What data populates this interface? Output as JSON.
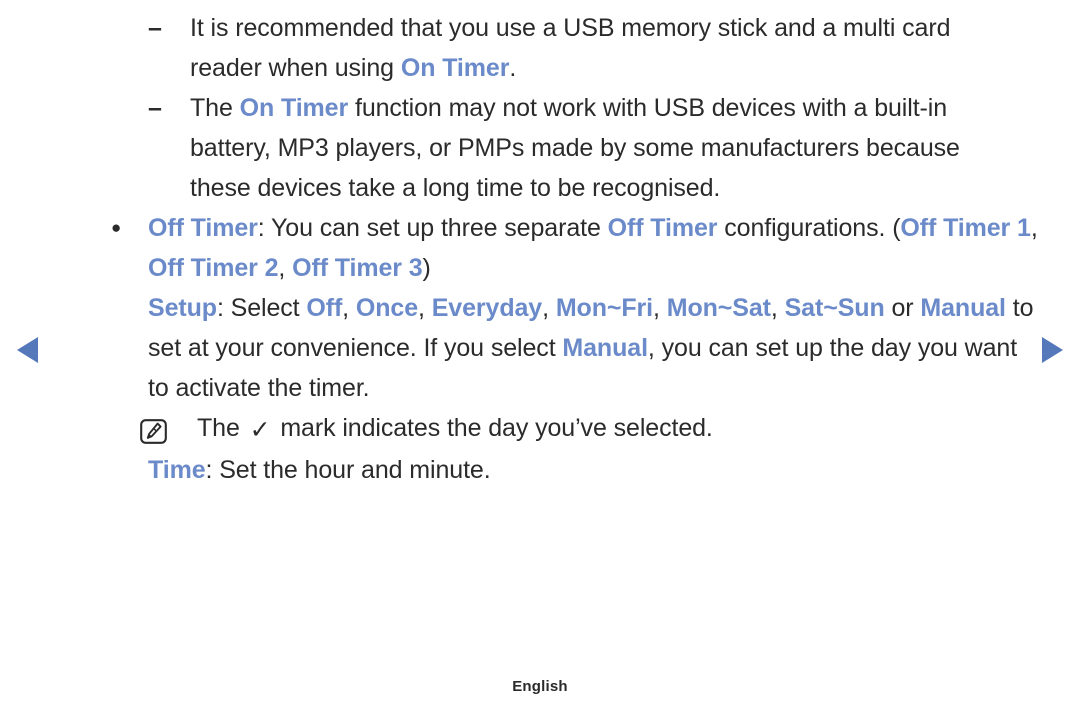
{
  "accent_color": "#6b8ac9",
  "text_color": "#2b2b2b",
  "nav": {
    "prev_label": "previous page",
    "next_label": "next page"
  },
  "body": {
    "note1": {
      "marker": "–",
      "text_1": "It is recommended that you use a USB memory stick and a multi card reader when using ",
      "term_1": "On Timer",
      "text_2": "."
    },
    "note2": {
      "marker": "–",
      "text_1": "The ",
      "term_1": "On Timer",
      "text_2": " function may not work with USB devices with a built-in battery, MP3 players, or PMPs made by some manufacturers because these devices take a long time to be recognised."
    },
    "offtimer": {
      "marker": "●",
      "term_1": "Off Timer",
      "text_1": ": You can set up three separate ",
      "term_2": "Off Timer",
      "text_2": " configurations. (",
      "term_3": "Off Timer 1",
      "text_3": ", ",
      "term_4": "Off Timer 2",
      "text_4": ", ",
      "term_5": "Off Timer 3",
      "text_5": ")"
    },
    "setup": {
      "term_1": "Setup",
      "text_1": ": Select ",
      "term_2": "Off",
      "text_2": ", ",
      "term_3": "Once",
      "text_3": ", ",
      "term_4": "Everyday",
      "text_4": ", ",
      "term_5": "Mon~Fri",
      "text_5": ", ",
      "term_6": "Mon~Sat",
      "text_6": ", ",
      "term_7": "Sat~Sun",
      "text_7": " or ",
      "term_8": "Manual",
      "text_8": " to set at your convenience. If you select ",
      "term_9": "Manual",
      "text_9": ", you can set up the day you want to activate the timer."
    },
    "tick_note": {
      "icon": "note-pencil-icon",
      "text_1": "The ",
      "tick": "✓",
      "text_2": " mark indicates the day you’ve selected."
    },
    "time": {
      "term_1": "Time",
      "text_1": ": Set the hour and minute."
    }
  },
  "footer": {
    "language": "English"
  }
}
